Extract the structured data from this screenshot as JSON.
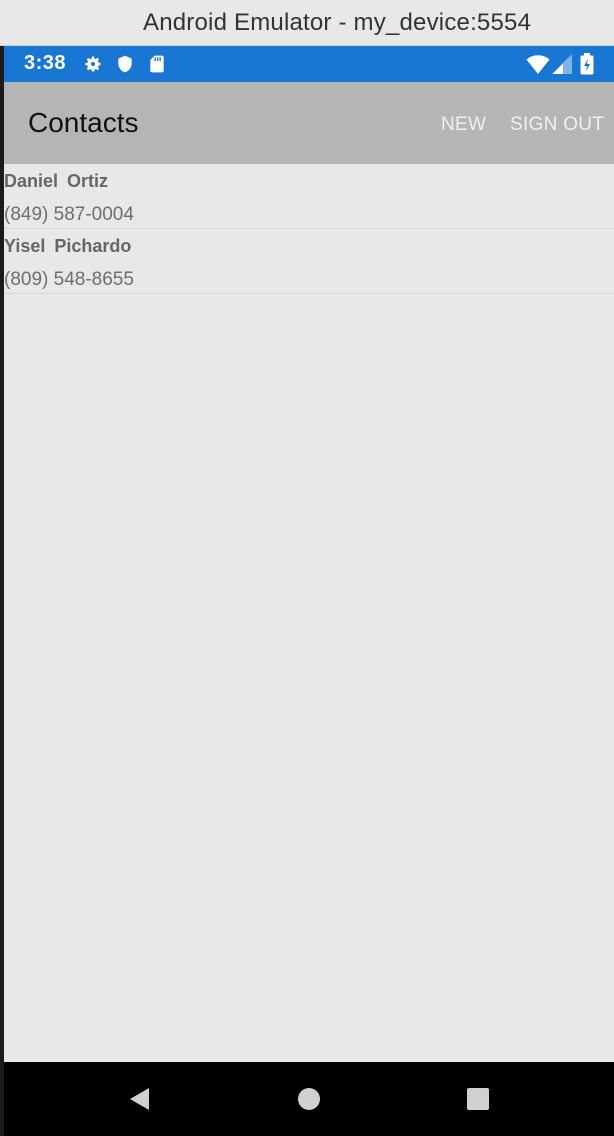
{
  "window": {
    "title": "Android Emulator - my_device:5554"
  },
  "status_bar": {
    "time": "3:38",
    "color": "#1976d2",
    "left_icons": [
      "gear-icon",
      "shield-icon",
      "sd-card-icon"
    ],
    "right_icons": [
      "wifi-icon",
      "cell-signal-icon",
      "battery-icon"
    ]
  },
  "app_bar": {
    "title": "Contacts",
    "actions": {
      "new_label": "NEW",
      "sign_out_label": "SIGN OUT"
    }
  },
  "contacts": [
    {
      "name": "Daniel  Ortiz",
      "phone": "(849) 587-0004"
    },
    {
      "name": "Yisel  Pichardo",
      "phone": "(809) 548-8655"
    }
  ],
  "nav_bar": {
    "buttons": [
      "back-icon",
      "home-icon",
      "recents-icon"
    ]
  }
}
